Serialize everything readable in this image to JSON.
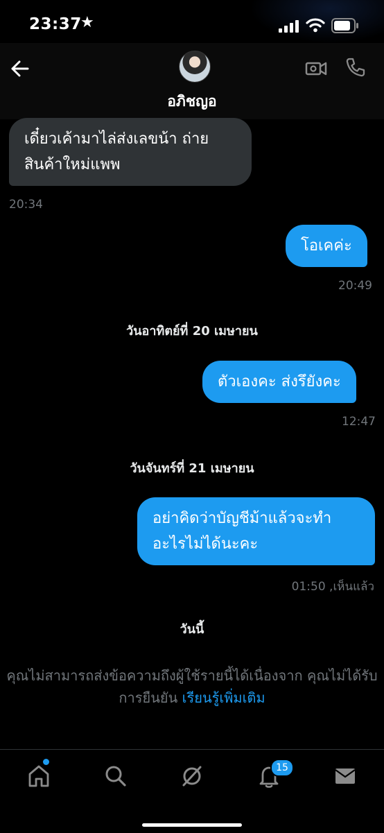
{
  "status_bar": {
    "time": "23:37",
    "star": "★"
  },
  "header": {
    "contact_name": "อภิชญอ"
  },
  "messages": [
    {
      "direction": "incoming",
      "text": "เดี๋ยวเค้ามาไล่ส่งเลขน้า ถ่ายสินค้าใหม่แพพ",
      "time": "20:34"
    },
    {
      "direction": "outgoing",
      "text": "โอเคค่ะ",
      "time": "20:49"
    },
    {
      "direction": "outgoing",
      "text": "ตัวเองคะ ส่งรึยังคะ",
      "time": "12:47"
    },
    {
      "direction": "outgoing",
      "text": "อย่าคิดว่าบัญชีม้าแล้วจะทำอะไรไม่ได้นะคะ",
      "time": "01:50  ,เห็นแล้ว"
    }
  ],
  "date_separators": [
    "วันอาทิตย์ที่ 20 เมษายน",
    "วันจันทร์ที่ 21 เมษายน",
    "วันนี้"
  ],
  "notice": {
    "text": "คุณไม่สามารถส่งข้อความถึงผู้ใช้รายนี้ได้เนื่องจาก คุณไม่ได้รับการยืนยัน",
    "link": "เรียนรู้เพิ่มเติม"
  },
  "bottom_nav": {
    "items": [
      "home-icon",
      "search-icon",
      "grok-icon",
      "notifications-icon",
      "messages-icon"
    ],
    "notification_count": "15"
  },
  "colors": {
    "accent": "#1d9bf0",
    "incoming_bubble": "#2f3336",
    "background": "#000000",
    "muted": "#71767b"
  }
}
